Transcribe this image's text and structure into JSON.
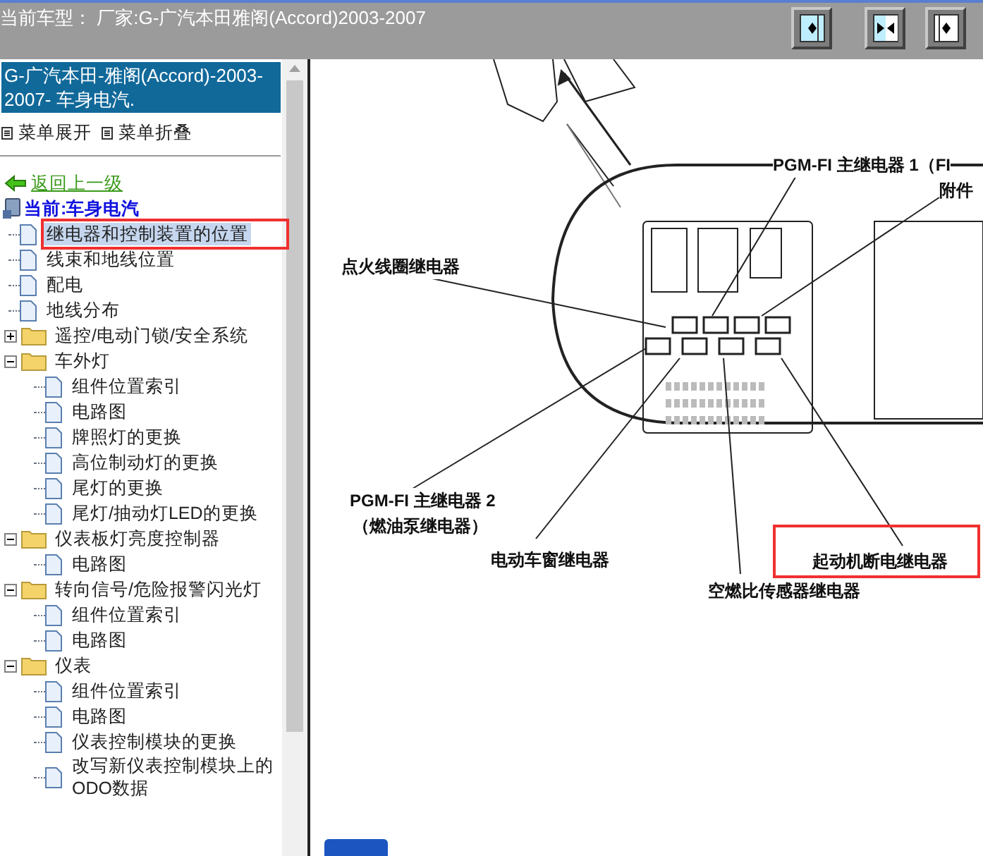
{
  "header": {
    "title": "当前车型： 厂家:G-广汽本田雅阁(Accord)2003-2007"
  },
  "sidebar": {
    "title": "G-广汽本田-雅阁(Accord)-2003-2007- 车身电汽.",
    "menu_buttons": [
      "菜单展开",
      "菜单折叠"
    ],
    "back_link": "返回上一级",
    "current": "当前:车身电汽",
    "tree": [
      {
        "kind": "page",
        "label": "继电器和控制装置的位置",
        "selected": true
      },
      {
        "kind": "page",
        "label": "线束和地线位置",
        "selected": false
      },
      {
        "kind": "page",
        "label": "配电",
        "selected": false
      },
      {
        "kind": "page",
        "label": "地线分布",
        "selected": false
      },
      {
        "kind": "folder",
        "label": "遥控/电动门锁/安全系统",
        "selected": false,
        "expanded": false
      },
      {
        "kind": "folder",
        "label": "车外灯",
        "selected": false,
        "expanded": true,
        "children": [
          {
            "kind": "page",
            "label": "组件位置索引",
            "selected": false
          },
          {
            "kind": "page",
            "label": "电路图",
            "selected": false
          },
          {
            "kind": "page",
            "label": "牌照灯的更换",
            "selected": false
          },
          {
            "kind": "page",
            "label": "高位制动灯的更换",
            "selected": false
          },
          {
            "kind": "page",
            "label": "尾灯的更换",
            "selected": false
          },
          {
            "kind": "page",
            "label": "尾灯/抽动灯LED的更换",
            "selected": false
          }
        ]
      },
      {
        "kind": "folder",
        "label": "仪表板灯亮度控制器",
        "selected": false,
        "expanded": true,
        "children": [
          {
            "kind": "page",
            "label": "电路图",
            "selected": false
          }
        ]
      },
      {
        "kind": "folder",
        "label": "转向信号/危险报警闪光灯",
        "selected": false,
        "expanded": true,
        "children": [
          {
            "kind": "page",
            "label": "组件位置索引",
            "selected": false
          },
          {
            "kind": "page",
            "label": "电路图",
            "selected": false
          }
        ]
      },
      {
        "kind": "folder",
        "label": "仪表",
        "selected": false,
        "expanded": true,
        "children": [
          {
            "kind": "page",
            "label": "组件位置索引",
            "selected": false
          },
          {
            "kind": "page",
            "label": "电路图",
            "selected": false
          },
          {
            "kind": "page",
            "label": "仪表控制模块的更换",
            "selected": false
          },
          {
            "kind": "page",
            "label": "改写新仪表控制模块上的ODO数据",
            "selected": false
          }
        ]
      }
    ]
  },
  "diagram": {
    "labels": [
      {
        "text": "PGM-FI 主继电器 1（FI"
      },
      {
        "text": "附件"
      },
      {
        "text": "点火线圈继电器"
      },
      {
        "text": "PGM-FI 主继电器 2"
      },
      {
        "text": "（燃油泵继电器）"
      },
      {
        "text": "电动车窗继电器"
      },
      {
        "text": "起动机断电继电器"
      },
      {
        "text": "空燃比传感器继电器"
      }
    ]
  }
}
